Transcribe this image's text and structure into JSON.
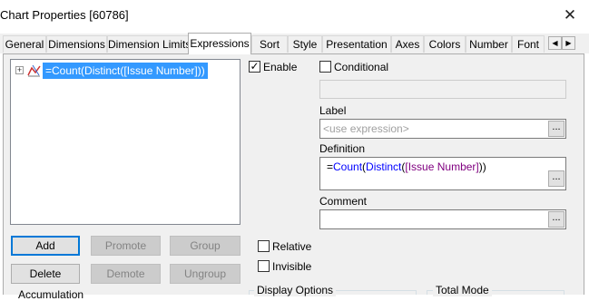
{
  "window": {
    "title": "Chart Properties [60786]",
    "close_glyph": "✕"
  },
  "tabs": [
    "General",
    "Dimensions",
    "Dimension Limits",
    "Expressions",
    "Sort",
    "Style",
    "Presentation",
    "Axes",
    "Colors",
    "Number",
    "Font"
  ],
  "active_tab": "Expressions",
  "tab_scroll": {
    "left": "◀",
    "right": "▶"
  },
  "tree": {
    "expander": "+",
    "expression": "=Count(Distinct([Issue Number]))"
  },
  "buttons": {
    "add": "Add",
    "promote": "Promote",
    "group": "Group",
    "delete": "Delete",
    "demote": "Demote",
    "ungroup": "Ungroup"
  },
  "accumulation_label": "Accumulation",
  "options": {
    "enable": {
      "label": "Enable",
      "checked": true
    },
    "conditional": {
      "label": "Conditional",
      "checked": false
    },
    "relative": {
      "label": "Relative",
      "checked": false
    },
    "invisible": {
      "label": "Invisible",
      "checked": false
    }
  },
  "label": {
    "caption": "Label",
    "placeholder": "<use expression>"
  },
  "definition": {
    "caption": "Definition",
    "prefix": "=",
    "func1": "Count",
    "paren1": "(",
    "func2": "Distinct",
    "paren2": "(",
    "field": "[Issue Number]",
    "close": "))"
  },
  "comment": {
    "caption": "Comment",
    "value": ""
  },
  "ellipsis": "...",
  "groups": {
    "display_options": "Display Options",
    "total_mode": "Total Mode"
  },
  "colors": {
    "selection": "#3399ff",
    "function_blue": "#0000ff",
    "field_purple": "#800080"
  }
}
